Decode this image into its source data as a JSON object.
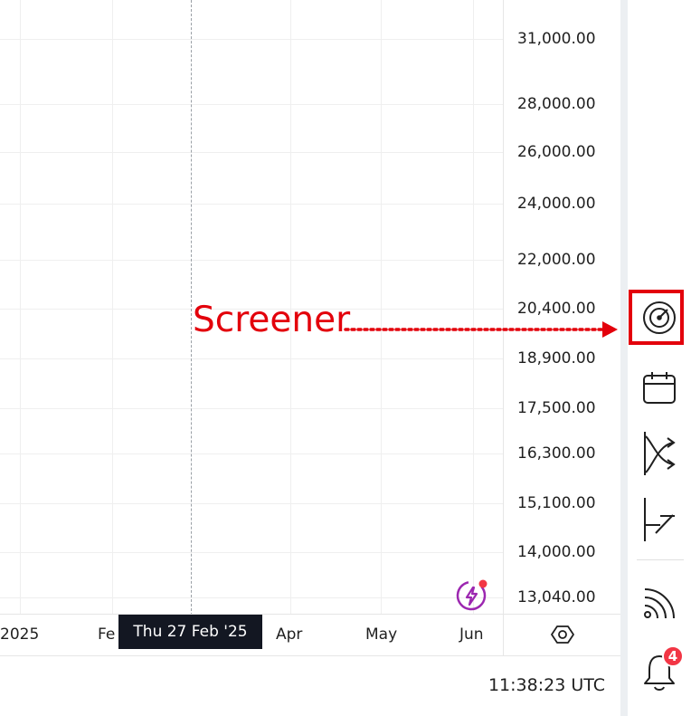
{
  "price_scale": {
    "labels": [
      "31,000.00",
      "28,000.00",
      "26,000.00",
      "24,000.00",
      "22,000.00",
      "20,400.00",
      "18,900.00",
      "17,500.00",
      "16,300.00",
      "15,100.00",
      "14,000.00",
      "13,040.00"
    ]
  },
  "time_axis": {
    "labels": [
      "2025",
      "Fe",
      "Apr",
      "May",
      "Jun"
    ],
    "crosshair_date": "Thu 27 Feb '25"
  },
  "status_bar": {
    "clock": "11:38:23 UTC"
  },
  "annotation": {
    "text": "Screener",
    "color": "#e3000b"
  },
  "right_toolbar": {
    "items": [
      {
        "icon": "screener-icon",
        "highlighted": true
      },
      {
        "icon": "calendar-icon"
      },
      {
        "icon": "options-icon"
      },
      {
        "icon": "pine-script-icon"
      },
      {
        "icon": "broadcast-icon"
      },
      {
        "icon": "notifications-icon"
      }
    ],
    "notifications_badge": "4"
  },
  "colors": {
    "highlight": "#e3000b",
    "tooltip_bg": "#131722",
    "badge": "#f23645",
    "lightning": "#9c27b0"
  }
}
